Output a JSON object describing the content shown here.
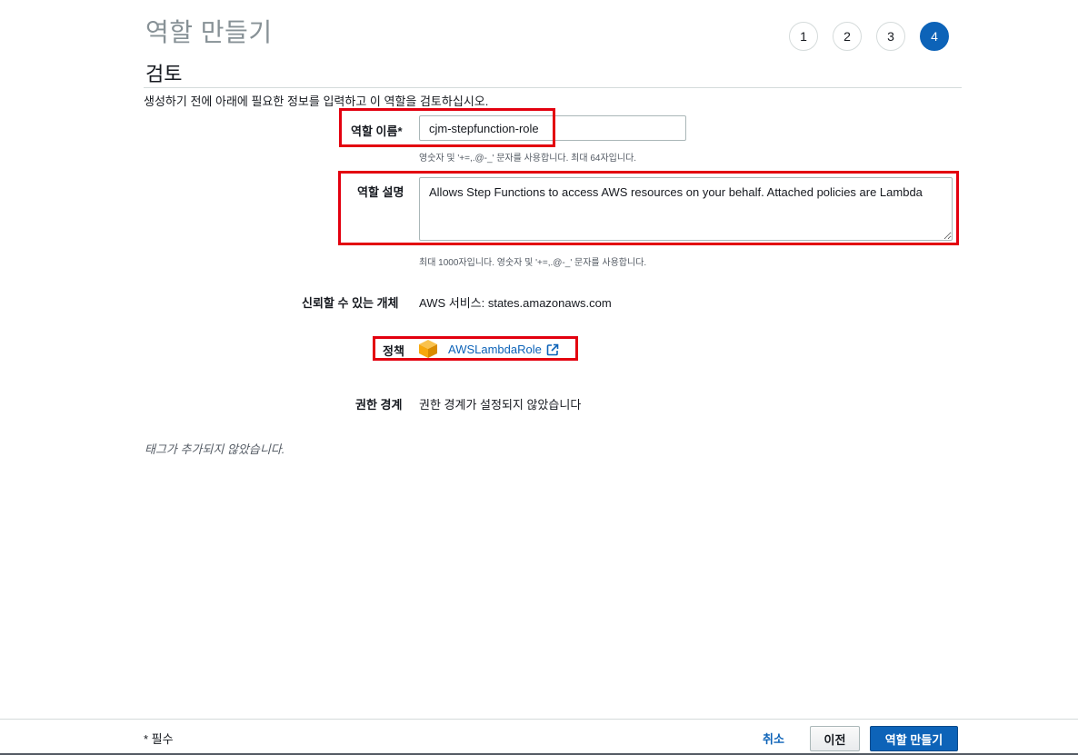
{
  "header": {
    "page_title": "역할 만들기",
    "steps": [
      {
        "label": "1",
        "active": false
      },
      {
        "label": "2",
        "active": false
      },
      {
        "label": "3",
        "active": false
      },
      {
        "label": "4",
        "active": true
      }
    ]
  },
  "review": {
    "section_title": "검토",
    "intro": "생성하기 전에 아래에 필요한 정보를 입력하고 이 역할을 검토하십시오.",
    "role_name": {
      "label": "역할 이름*",
      "value": "cjm-stepfunction-role",
      "hint": "영숫자 및 '+=,.@-_' 문자를 사용합니다. 최대 64자입니다."
    },
    "role_description": {
      "label": "역할 설명",
      "value": "Allows Step Functions to access AWS resources on your behalf. Attached policies are Lambda",
      "hint": "최대 1000자입니다. 영숫자 및 '+=,.@-_' 문자를 사용합니다."
    },
    "trusted_entities": {
      "label": "신뢰할 수 있는 개체",
      "value": "AWS 서비스: states.amazonaws.com"
    },
    "policies": {
      "label": "정책",
      "items": [
        "AWSLambdaRole"
      ],
      "icon": "aws-managed-policy-box-icon"
    },
    "permissions_boundary": {
      "label": "권한 경계",
      "value": "권한 경계가 설정되지 않았습니다"
    },
    "tags_note": "태그가 추가되지 않았습니다."
  },
  "footer": {
    "required_note": "* 필수",
    "cancel_label": "취소",
    "previous_label": "이전",
    "create_label": "역할 만들기"
  },
  "colors": {
    "accent": "#0d63b8",
    "highlight_box": "#e3000f",
    "policy_icon": "#f7a80d"
  }
}
